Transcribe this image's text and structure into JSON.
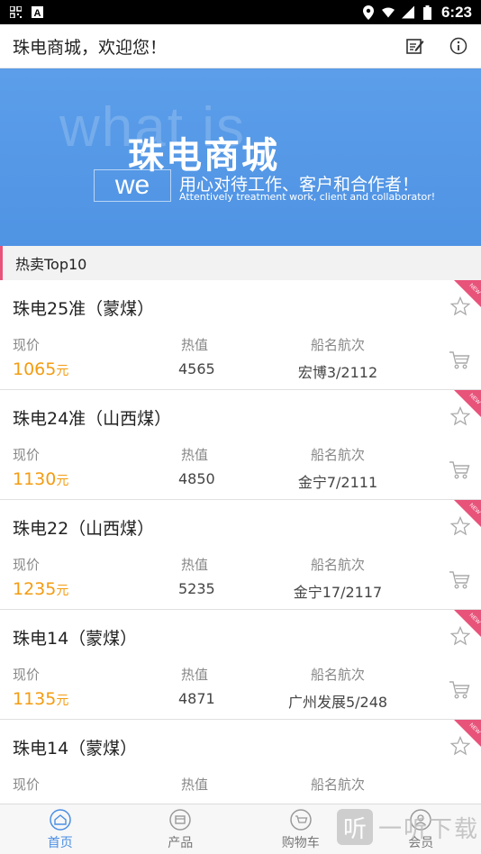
{
  "status_bar": {
    "time": "6:23"
  },
  "header": {
    "title": "珠电商城，欢迎您！",
    "icons": [
      "edit-icon",
      "info-icon"
    ]
  },
  "banner": {
    "ghost_text": "what is",
    "title": "珠电商城",
    "we_text": "we",
    "subtitle": "用心对待工作、客户和合作者！",
    "subtitle_en": "Attentively treatment work, client and collaborator!"
  },
  "section": {
    "title": "热卖Top10"
  },
  "labels": {
    "price": "现价",
    "hot": "热值",
    "ship": "船名航次",
    "unit": "元"
  },
  "products": [
    {
      "name": "珠电25准（蒙煤）",
      "price": "1065",
      "hot": "4565",
      "ship": "宏博3/2112"
    },
    {
      "name": "珠电24准（山西煤）",
      "price": "1130",
      "hot": "4850",
      "ship": "金宁7/2111"
    },
    {
      "name": "珠电22（山西煤）",
      "price": "1235",
      "hot": "5235",
      "ship": "金宁17/2117"
    },
    {
      "name": "珠电14（蒙煤）",
      "price": "1135",
      "hot": "4871",
      "ship": "广州发展5/248"
    },
    {
      "name": "珠电14（蒙煤）",
      "price": "",
      "hot": "",
      "ship": ""
    }
  ],
  "nav": [
    {
      "label": "首页",
      "icon": "home-icon",
      "active": true
    },
    {
      "label": "产品",
      "icon": "product-icon",
      "active": false
    },
    {
      "label": "购物车",
      "icon": "cart-icon",
      "active": false
    },
    {
      "label": "会员",
      "icon": "member-icon",
      "active": false
    }
  ],
  "watermark": {
    "text": "一听下载",
    "logo": "听"
  },
  "colors": {
    "accent": "#4a8ee3",
    "price": "#f39c12",
    "banner": "#5c9ee9",
    "new_badge": "#e8537a"
  }
}
